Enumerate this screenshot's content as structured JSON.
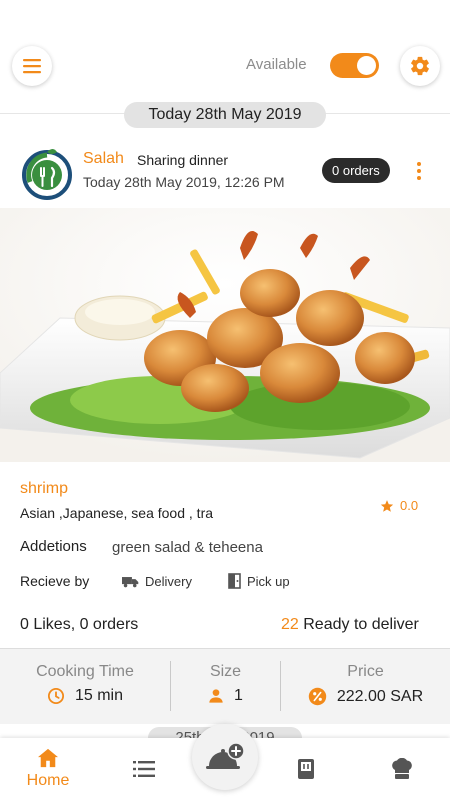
{
  "header": {
    "available_label": "Available",
    "available_on": true,
    "menu_icon": "hamburger-menu-icon",
    "settings_icon": "gear-icon"
  },
  "date_separator": "Today 28th May 2019",
  "post": {
    "author": "Salah",
    "type": "Sharing dinner",
    "time": "Today 28th May 2019, 12:26 PM",
    "orders_badge": "0 orders",
    "dish_name": "shrimp",
    "cuisine": "Asian ,Japanese, sea food , tra",
    "rating": "0.0",
    "addetions_label": "Addetions",
    "addetions_value": "green salad & teheena",
    "recieve_label": "Recieve by",
    "delivery_label": "Delivery",
    "pickup_label": "Pick up",
    "likes_orders": "0 Likes, 0 orders",
    "ready_count": "22",
    "ready_label": "Ready to deliver"
  },
  "stats": {
    "cooking_time_title": "Cooking Time",
    "cooking_time_value": "15 min",
    "size_title": "Size",
    "size_value": "1",
    "price_title": "Price",
    "price_value": "222.00 SAR"
  },
  "next_date_separator": "25th May 2019",
  "bottom_nav": {
    "home_label": "Home"
  },
  "colors": {
    "accent": "#f28a1a",
    "dark_badge": "#2b2b2b",
    "pill_bg": "#e3e3e3",
    "logo_green": "#3a8f3f",
    "logo_blue": "#1d4f7a"
  }
}
